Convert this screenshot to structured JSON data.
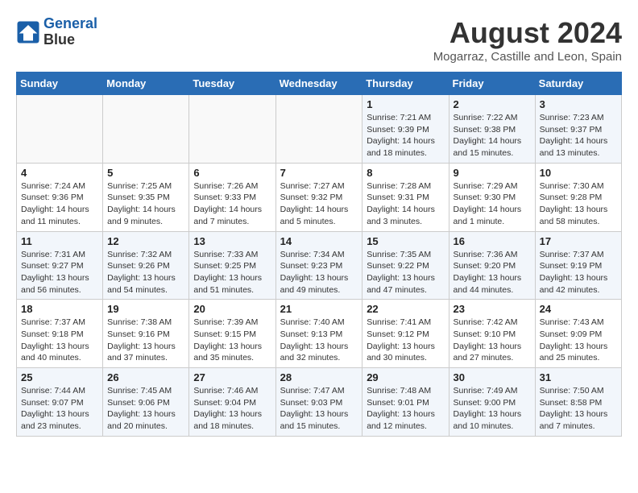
{
  "header": {
    "logo_line1": "General",
    "logo_line2": "Blue",
    "month": "August 2024",
    "location": "Mogarraz, Castille and Leon, Spain"
  },
  "weekdays": [
    "Sunday",
    "Monday",
    "Tuesday",
    "Wednesday",
    "Thursday",
    "Friday",
    "Saturday"
  ],
  "weeks": [
    [
      {
        "day": "",
        "info": ""
      },
      {
        "day": "",
        "info": ""
      },
      {
        "day": "",
        "info": ""
      },
      {
        "day": "",
        "info": ""
      },
      {
        "day": "1",
        "info": "Sunrise: 7:21 AM\nSunset: 9:39 PM\nDaylight: 14 hours\nand 18 minutes."
      },
      {
        "day": "2",
        "info": "Sunrise: 7:22 AM\nSunset: 9:38 PM\nDaylight: 14 hours\nand 15 minutes."
      },
      {
        "day": "3",
        "info": "Sunrise: 7:23 AM\nSunset: 9:37 PM\nDaylight: 14 hours\nand 13 minutes."
      }
    ],
    [
      {
        "day": "4",
        "info": "Sunrise: 7:24 AM\nSunset: 9:36 PM\nDaylight: 14 hours\nand 11 minutes."
      },
      {
        "day": "5",
        "info": "Sunrise: 7:25 AM\nSunset: 9:35 PM\nDaylight: 14 hours\nand 9 minutes."
      },
      {
        "day": "6",
        "info": "Sunrise: 7:26 AM\nSunset: 9:33 PM\nDaylight: 14 hours\nand 7 minutes."
      },
      {
        "day": "7",
        "info": "Sunrise: 7:27 AM\nSunset: 9:32 PM\nDaylight: 14 hours\nand 5 minutes."
      },
      {
        "day": "8",
        "info": "Sunrise: 7:28 AM\nSunset: 9:31 PM\nDaylight: 14 hours\nand 3 minutes."
      },
      {
        "day": "9",
        "info": "Sunrise: 7:29 AM\nSunset: 9:30 PM\nDaylight: 14 hours\nand 1 minute."
      },
      {
        "day": "10",
        "info": "Sunrise: 7:30 AM\nSunset: 9:28 PM\nDaylight: 13 hours\nand 58 minutes."
      }
    ],
    [
      {
        "day": "11",
        "info": "Sunrise: 7:31 AM\nSunset: 9:27 PM\nDaylight: 13 hours\nand 56 minutes."
      },
      {
        "day": "12",
        "info": "Sunrise: 7:32 AM\nSunset: 9:26 PM\nDaylight: 13 hours\nand 54 minutes."
      },
      {
        "day": "13",
        "info": "Sunrise: 7:33 AM\nSunset: 9:25 PM\nDaylight: 13 hours\nand 51 minutes."
      },
      {
        "day": "14",
        "info": "Sunrise: 7:34 AM\nSunset: 9:23 PM\nDaylight: 13 hours\nand 49 minutes."
      },
      {
        "day": "15",
        "info": "Sunrise: 7:35 AM\nSunset: 9:22 PM\nDaylight: 13 hours\nand 47 minutes."
      },
      {
        "day": "16",
        "info": "Sunrise: 7:36 AM\nSunset: 9:20 PM\nDaylight: 13 hours\nand 44 minutes."
      },
      {
        "day": "17",
        "info": "Sunrise: 7:37 AM\nSunset: 9:19 PM\nDaylight: 13 hours\nand 42 minutes."
      }
    ],
    [
      {
        "day": "18",
        "info": "Sunrise: 7:37 AM\nSunset: 9:18 PM\nDaylight: 13 hours\nand 40 minutes."
      },
      {
        "day": "19",
        "info": "Sunrise: 7:38 AM\nSunset: 9:16 PM\nDaylight: 13 hours\nand 37 minutes."
      },
      {
        "day": "20",
        "info": "Sunrise: 7:39 AM\nSunset: 9:15 PM\nDaylight: 13 hours\nand 35 minutes."
      },
      {
        "day": "21",
        "info": "Sunrise: 7:40 AM\nSunset: 9:13 PM\nDaylight: 13 hours\nand 32 minutes."
      },
      {
        "day": "22",
        "info": "Sunrise: 7:41 AM\nSunset: 9:12 PM\nDaylight: 13 hours\nand 30 minutes."
      },
      {
        "day": "23",
        "info": "Sunrise: 7:42 AM\nSunset: 9:10 PM\nDaylight: 13 hours\nand 27 minutes."
      },
      {
        "day": "24",
        "info": "Sunrise: 7:43 AM\nSunset: 9:09 PM\nDaylight: 13 hours\nand 25 minutes."
      }
    ],
    [
      {
        "day": "25",
        "info": "Sunrise: 7:44 AM\nSunset: 9:07 PM\nDaylight: 13 hours\nand 23 minutes."
      },
      {
        "day": "26",
        "info": "Sunrise: 7:45 AM\nSunset: 9:06 PM\nDaylight: 13 hours\nand 20 minutes."
      },
      {
        "day": "27",
        "info": "Sunrise: 7:46 AM\nSunset: 9:04 PM\nDaylight: 13 hours\nand 18 minutes."
      },
      {
        "day": "28",
        "info": "Sunrise: 7:47 AM\nSunset: 9:03 PM\nDaylight: 13 hours\nand 15 minutes."
      },
      {
        "day": "29",
        "info": "Sunrise: 7:48 AM\nSunset: 9:01 PM\nDaylight: 13 hours\nand 12 minutes."
      },
      {
        "day": "30",
        "info": "Sunrise: 7:49 AM\nSunset: 9:00 PM\nDaylight: 13 hours\nand 10 minutes."
      },
      {
        "day": "31",
        "info": "Sunrise: 7:50 AM\nSunset: 8:58 PM\nDaylight: 13 hours\nand 7 minutes."
      }
    ]
  ]
}
